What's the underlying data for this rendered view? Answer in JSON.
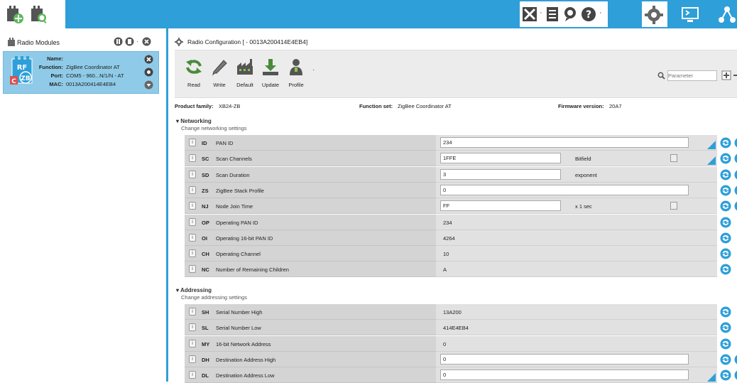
{
  "left_panel": {
    "title": "Radio Modules",
    "module": {
      "badge_top": "RF",
      "badge_bottom": "ZB",
      "badge_corner": "C",
      "name_label": "Name:",
      "name_value": "",
      "function_label": "Function:",
      "function_value": "ZigBee Coordinator AT",
      "port_label": "Port:",
      "port_value": "COM5 - 960...N/1/N - AT",
      "mac_label": "MAC:",
      "mac_value": "0013A200414E4EB4"
    }
  },
  "main": {
    "title": "Radio Configuration [ - 0013A200414E4EB4]",
    "toolbar": {
      "read": "Read",
      "write": "Write",
      "default": "Default",
      "update": "Update",
      "profile": "Profile",
      "search_placeholder": "Parameter"
    },
    "info": {
      "family_label": "Product family:",
      "family_value": "XB24-ZB",
      "function_label": "Function set:",
      "function_value": "ZigBee Coordinator AT",
      "firmware_label": "Firmware version:",
      "firmware_value": "20A7"
    },
    "networking": {
      "title": "Networking",
      "subtitle": "Change networking settings",
      "rows": [
        {
          "code": "ID",
          "name": "PAN ID",
          "value": "234",
          "unit": ""
        },
        {
          "code": "SC",
          "name": "Scan Channels",
          "value": "1FFE",
          "unit": "Bitfield"
        },
        {
          "code": "SD",
          "name": "Scan Duration",
          "value": "3",
          "unit": "exponent"
        },
        {
          "code": "ZS",
          "name": "ZigBee Stack Profile",
          "value": "0",
          "unit": ""
        },
        {
          "code": "NJ",
          "name": "Node Join Time",
          "value": "FF",
          "unit": "x 1 sec"
        },
        {
          "code": "OP",
          "name": "Operating PAN ID",
          "value": "234",
          "unit": ""
        },
        {
          "code": "OI",
          "name": "Operating 16-bit PAN ID",
          "value": "4264",
          "unit": ""
        },
        {
          "code": "CH",
          "name": "Operating Channel",
          "value": "10",
          "unit": ""
        },
        {
          "code": "NC",
          "name": "Number of Remaining Children",
          "value": "A",
          "unit": ""
        }
      ]
    },
    "addressing": {
      "title": "Addressing",
      "subtitle": "Change addressing settings",
      "rows": [
        {
          "code": "SH",
          "name": "Serial Number High",
          "value": "13A200",
          "unit": ""
        },
        {
          "code": "SL",
          "name": "Serial Number Low",
          "value": "414E4EB4",
          "unit": ""
        },
        {
          "code": "MY",
          "name": "16-bit Network Address",
          "value": "0",
          "unit": ""
        },
        {
          "code": "DH",
          "name": "Destination Address High",
          "value": "0",
          "unit": ""
        },
        {
          "code": "DL",
          "name": "Destination Address Low",
          "value": "0",
          "unit": ""
        }
      ]
    }
  },
  "info_glyph": "i",
  "colors": {
    "accent": "#2e9fd8",
    "action_blue": "#2e9fd8",
    "row_label_bg": "#d4d4d4"
  }
}
